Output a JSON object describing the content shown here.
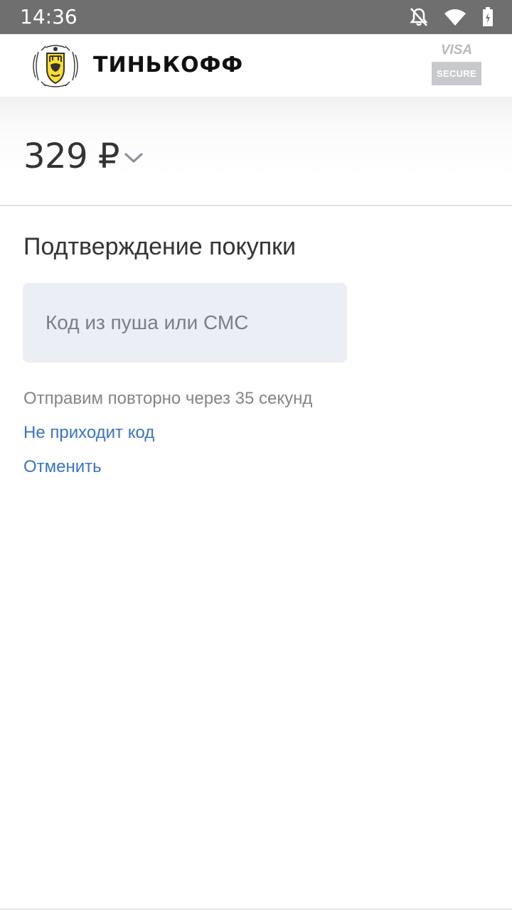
{
  "status_bar": {
    "time": "14:36",
    "icons": [
      "notifications-off-icon",
      "wifi-icon",
      "battery-charging-icon"
    ]
  },
  "header": {
    "brand": "ТИНЬКОФФ",
    "logo_icon": "tinkoff-emblem-icon",
    "visa_text": "VISA",
    "secure_text": "SECURE"
  },
  "payment": {
    "amount": "329 ₽",
    "expand_icon": "chevron-down-icon"
  },
  "confirmation": {
    "title": "Подтверждение покупки",
    "code_placeholder": "Код из пуша или СМС",
    "code_value": "",
    "resend_text": "Отправим повторно через 35 секунд",
    "no_code_link": "Не приходит код",
    "cancel_link": "Отменить"
  },
  "colors": {
    "status_bar": "#6f6f6f",
    "link": "#3b74c7",
    "input_bg": "#ebeff5",
    "emblem_yellow": "#ffdd2d"
  }
}
